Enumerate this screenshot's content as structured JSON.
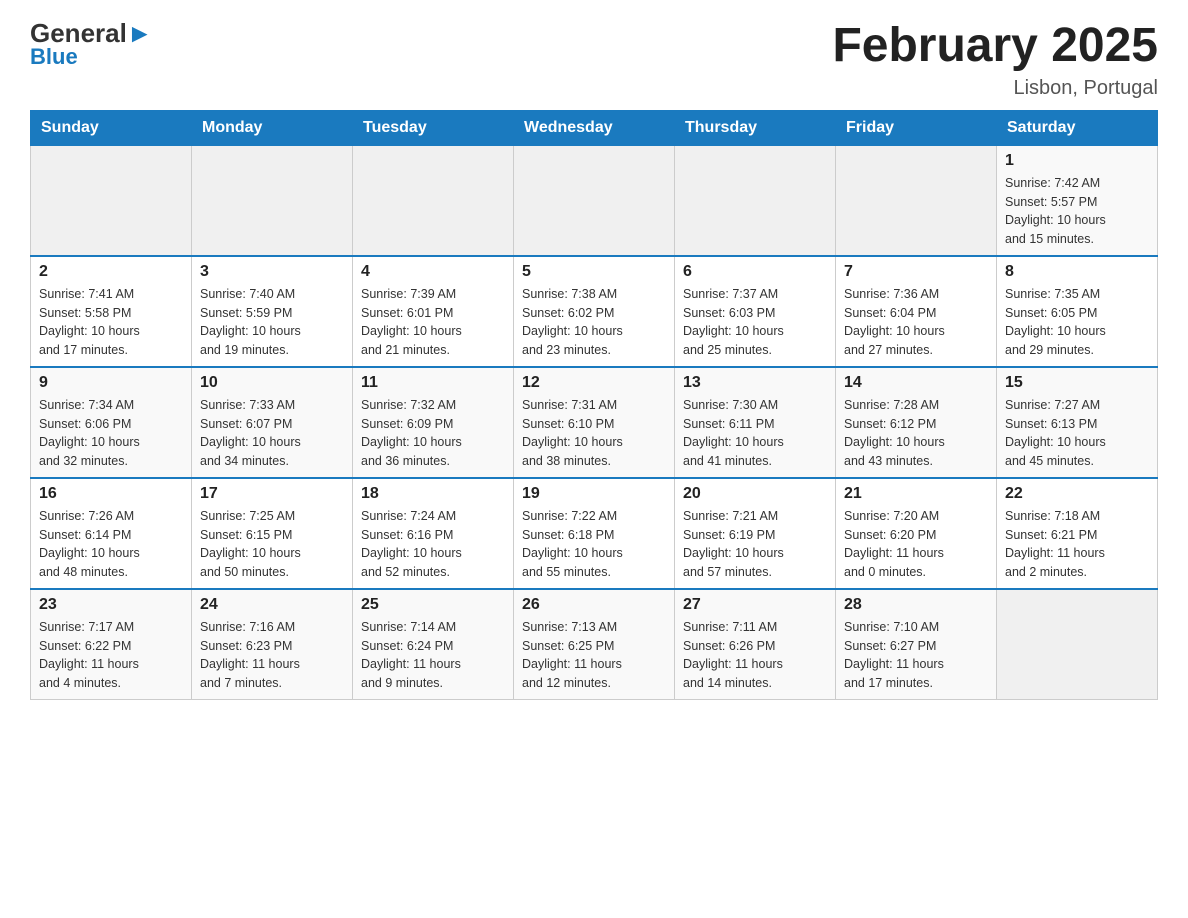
{
  "header": {
    "logo_general": "General",
    "logo_blue": "Blue",
    "title": "February 2025",
    "subtitle": "Lisbon, Portugal"
  },
  "days_of_week": [
    "Sunday",
    "Monday",
    "Tuesday",
    "Wednesday",
    "Thursday",
    "Friday",
    "Saturday"
  ],
  "weeks": [
    {
      "days": [
        {
          "num": "",
          "info": ""
        },
        {
          "num": "",
          "info": ""
        },
        {
          "num": "",
          "info": ""
        },
        {
          "num": "",
          "info": ""
        },
        {
          "num": "",
          "info": ""
        },
        {
          "num": "",
          "info": ""
        },
        {
          "num": "1",
          "info": "Sunrise: 7:42 AM\nSunset: 5:57 PM\nDaylight: 10 hours\nand 15 minutes."
        }
      ]
    },
    {
      "days": [
        {
          "num": "2",
          "info": "Sunrise: 7:41 AM\nSunset: 5:58 PM\nDaylight: 10 hours\nand 17 minutes."
        },
        {
          "num": "3",
          "info": "Sunrise: 7:40 AM\nSunset: 5:59 PM\nDaylight: 10 hours\nand 19 minutes."
        },
        {
          "num": "4",
          "info": "Sunrise: 7:39 AM\nSunset: 6:01 PM\nDaylight: 10 hours\nand 21 minutes."
        },
        {
          "num": "5",
          "info": "Sunrise: 7:38 AM\nSunset: 6:02 PM\nDaylight: 10 hours\nand 23 minutes."
        },
        {
          "num": "6",
          "info": "Sunrise: 7:37 AM\nSunset: 6:03 PM\nDaylight: 10 hours\nand 25 minutes."
        },
        {
          "num": "7",
          "info": "Sunrise: 7:36 AM\nSunset: 6:04 PM\nDaylight: 10 hours\nand 27 minutes."
        },
        {
          "num": "8",
          "info": "Sunrise: 7:35 AM\nSunset: 6:05 PM\nDaylight: 10 hours\nand 29 minutes."
        }
      ]
    },
    {
      "days": [
        {
          "num": "9",
          "info": "Sunrise: 7:34 AM\nSunset: 6:06 PM\nDaylight: 10 hours\nand 32 minutes."
        },
        {
          "num": "10",
          "info": "Sunrise: 7:33 AM\nSunset: 6:07 PM\nDaylight: 10 hours\nand 34 minutes."
        },
        {
          "num": "11",
          "info": "Sunrise: 7:32 AM\nSunset: 6:09 PM\nDaylight: 10 hours\nand 36 minutes."
        },
        {
          "num": "12",
          "info": "Sunrise: 7:31 AM\nSunset: 6:10 PM\nDaylight: 10 hours\nand 38 minutes."
        },
        {
          "num": "13",
          "info": "Sunrise: 7:30 AM\nSunset: 6:11 PM\nDaylight: 10 hours\nand 41 minutes."
        },
        {
          "num": "14",
          "info": "Sunrise: 7:28 AM\nSunset: 6:12 PM\nDaylight: 10 hours\nand 43 minutes."
        },
        {
          "num": "15",
          "info": "Sunrise: 7:27 AM\nSunset: 6:13 PM\nDaylight: 10 hours\nand 45 minutes."
        }
      ]
    },
    {
      "days": [
        {
          "num": "16",
          "info": "Sunrise: 7:26 AM\nSunset: 6:14 PM\nDaylight: 10 hours\nand 48 minutes."
        },
        {
          "num": "17",
          "info": "Sunrise: 7:25 AM\nSunset: 6:15 PM\nDaylight: 10 hours\nand 50 minutes."
        },
        {
          "num": "18",
          "info": "Sunrise: 7:24 AM\nSunset: 6:16 PM\nDaylight: 10 hours\nand 52 minutes."
        },
        {
          "num": "19",
          "info": "Sunrise: 7:22 AM\nSunset: 6:18 PM\nDaylight: 10 hours\nand 55 minutes."
        },
        {
          "num": "20",
          "info": "Sunrise: 7:21 AM\nSunset: 6:19 PM\nDaylight: 10 hours\nand 57 minutes."
        },
        {
          "num": "21",
          "info": "Sunrise: 7:20 AM\nSunset: 6:20 PM\nDaylight: 11 hours\nand 0 minutes."
        },
        {
          "num": "22",
          "info": "Sunrise: 7:18 AM\nSunset: 6:21 PM\nDaylight: 11 hours\nand 2 minutes."
        }
      ]
    },
    {
      "days": [
        {
          "num": "23",
          "info": "Sunrise: 7:17 AM\nSunset: 6:22 PM\nDaylight: 11 hours\nand 4 minutes."
        },
        {
          "num": "24",
          "info": "Sunrise: 7:16 AM\nSunset: 6:23 PM\nDaylight: 11 hours\nand 7 minutes."
        },
        {
          "num": "25",
          "info": "Sunrise: 7:14 AM\nSunset: 6:24 PM\nDaylight: 11 hours\nand 9 minutes."
        },
        {
          "num": "26",
          "info": "Sunrise: 7:13 AM\nSunset: 6:25 PM\nDaylight: 11 hours\nand 12 minutes."
        },
        {
          "num": "27",
          "info": "Sunrise: 7:11 AM\nSunset: 6:26 PM\nDaylight: 11 hours\nand 14 minutes."
        },
        {
          "num": "28",
          "info": "Sunrise: 7:10 AM\nSunset: 6:27 PM\nDaylight: 11 hours\nand 17 minutes."
        },
        {
          "num": "",
          "info": ""
        }
      ]
    }
  ]
}
